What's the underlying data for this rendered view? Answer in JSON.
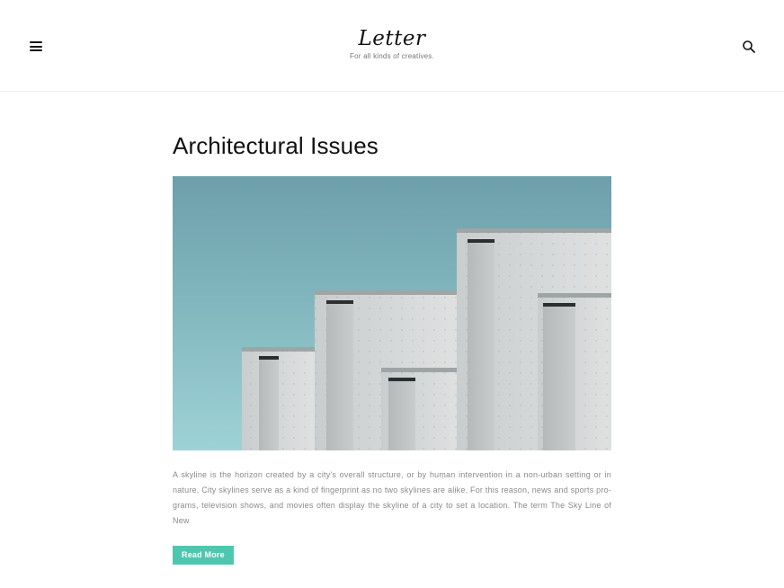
{
  "site": {
    "title": "Letter",
    "tagline": "For all kinds of creatives."
  },
  "header": {
    "menu_icon": "hamburger-menu-icon",
    "search_icon": "search-icon"
  },
  "post": {
    "title": "Architectural Issues",
    "image_alt": "Concrete buildings against a teal sky",
    "excerpt": "A skyline is the horizon created by a city's overall structure, or by human intervention in a non-urban setting or in nature. City skylines serve as a kind of fingerprint as no two skylines are alike. For this reason, news and sports pro-grams, television shows, and movies often display the skyline of a city to set a location. The term The Sky Line of New",
    "read_more_label": "Read More"
  },
  "colors": {
    "accent": "#4fc7b0",
    "sky": "#74a9b3",
    "concrete": "#cfd2d3"
  }
}
